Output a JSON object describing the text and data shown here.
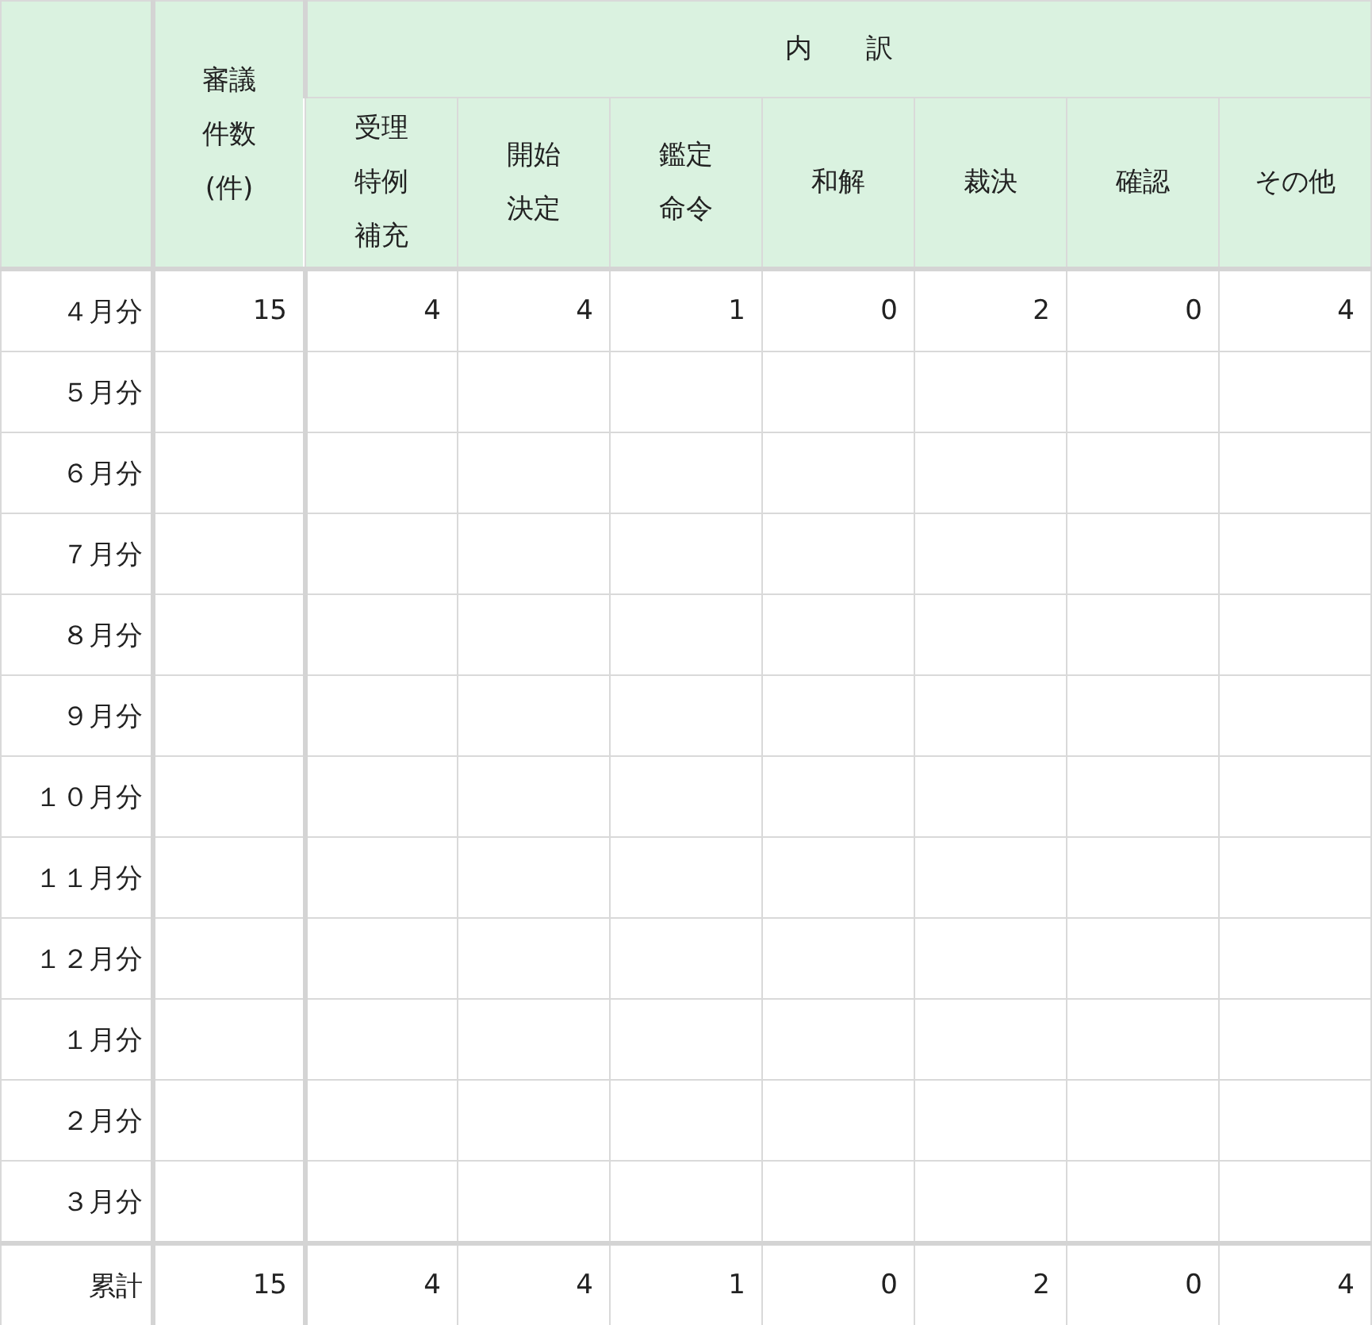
{
  "table": {
    "count_column": "審議件数(件)",
    "group_header": "内　　訳",
    "sub_columns": [
      "受理特例補充",
      "開始決定",
      "鑑定命令",
      "和解",
      "裁決",
      "確認",
      "その他"
    ],
    "rows": [
      {
        "label": "４月分",
        "values": [
          "15",
          "4",
          "4",
          "1",
          "0",
          "2",
          "0",
          "4"
        ]
      },
      {
        "label": "５月分"
      },
      {
        "label": "６月分"
      },
      {
        "label": "７月分"
      },
      {
        "label": "８月分"
      },
      {
        "label": "９月分"
      },
      {
        "label": "１０月分"
      },
      {
        "label": "１１月分"
      },
      {
        "label": "１２月分"
      },
      {
        "label": "１月分"
      },
      {
        "label": "２月分"
      },
      {
        "label": "３月分"
      }
    ],
    "total": {
      "label": "累計",
      "values": [
        "15",
        "4",
        "4",
        "1",
        "0",
        "2",
        "0",
        "4"
      ]
    }
  }
}
